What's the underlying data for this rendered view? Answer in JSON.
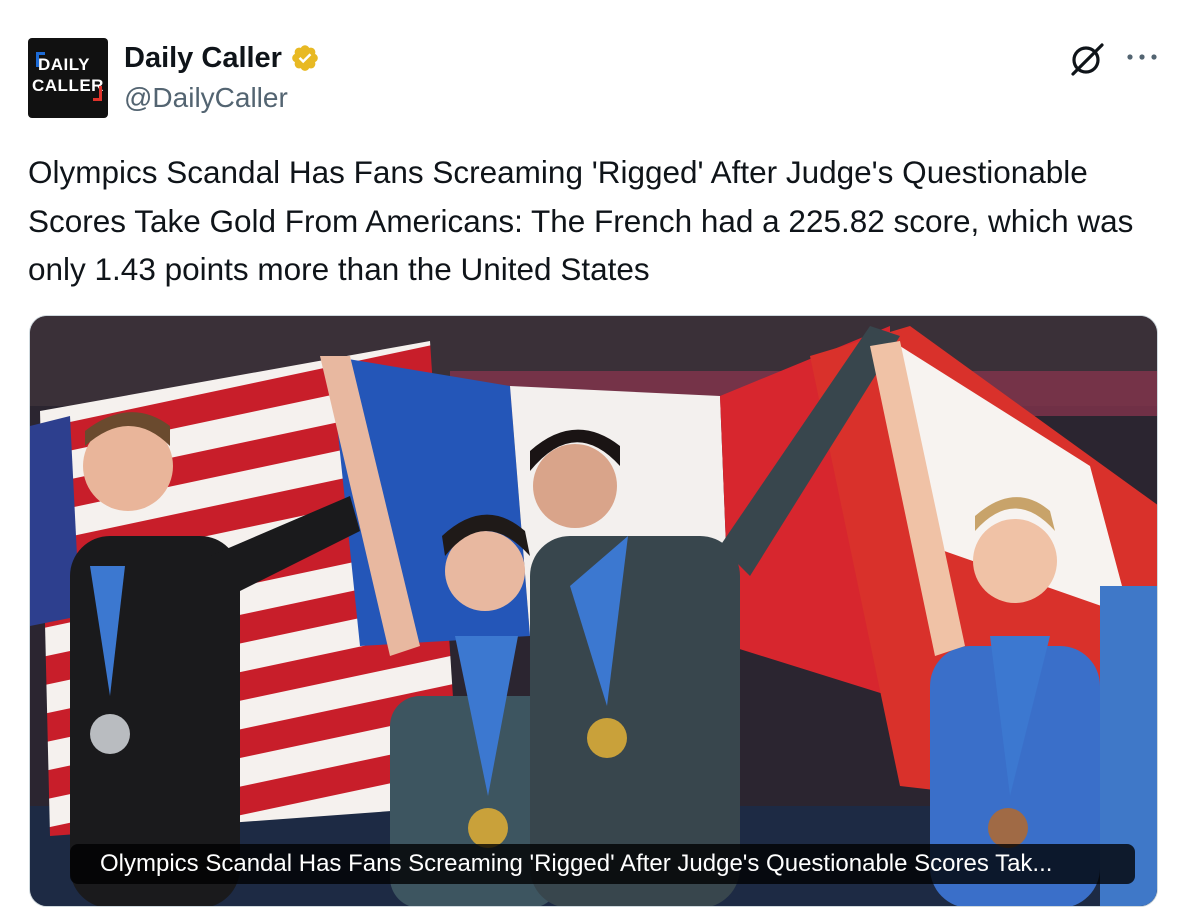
{
  "author": {
    "display_name": "Daily Caller",
    "handle": "@DailyCaller",
    "verified": true,
    "verified_badge_color": "#e8b923",
    "avatar_text_line1": "DAILY",
    "avatar_text_line2": "CALLER",
    "avatar_icon": "daily-caller-logo"
  },
  "actions": {
    "grok_icon": "grok-icon",
    "more_icon": "more-icon"
  },
  "tweet": {
    "text": "Olympics Scandal Has Fans Screaming 'Rigged' After Judge's Questionable Scores Take Gold From Americans: The French had a 225.82 score, which was only 1.43 points more than the United States"
  },
  "media": {
    "type": "link-card-image",
    "caption": "Olympics Scandal Has Fans Screaming 'Rigged' After Judge's Questionable Scores Tak..."
  },
  "colors": {
    "text_primary": "#0f1419",
    "text_secondary": "#536471",
    "card_border": "#cfd9de"
  }
}
